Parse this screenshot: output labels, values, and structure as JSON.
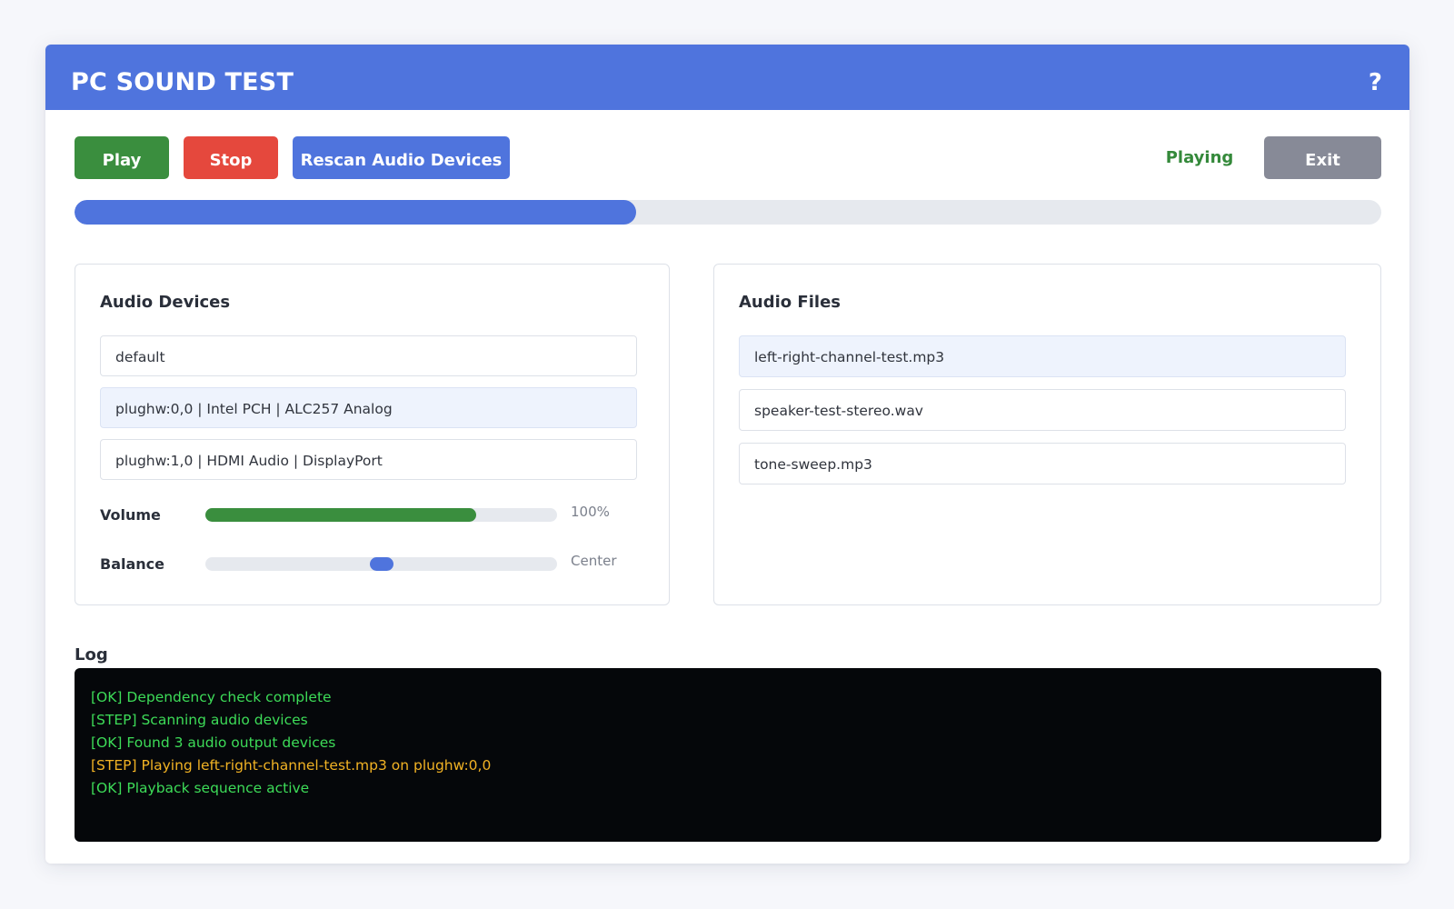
{
  "app": {
    "title": "PC SOUND TEST",
    "help_label": "?"
  },
  "toolbar": {
    "play_label": "Play",
    "stop_label": "Stop",
    "rescan_label": "Rescan Audio Devices",
    "exit_label": "Exit",
    "status": "Playing"
  },
  "progress": {
    "value": 0.43
  },
  "devices": {
    "title": "Audio Devices",
    "items": [
      {
        "label": "default",
        "selected": false
      },
      {
        "label": "plughw:0,0 | Intel PCH | ALC257 Analog",
        "selected": true
      },
      {
        "label": "plughw:1,0 | HDMI Audio | DisplayPort",
        "selected": false
      }
    ],
    "volume": {
      "label": "Volume",
      "value_text": "100%",
      "level": 0.77
    },
    "balance": {
      "label": "Balance",
      "value_text": "Center",
      "position": 0.5
    }
  },
  "files": {
    "title": "Audio Files",
    "items": [
      {
        "label": "left-right-channel-test.mp3",
        "selected": true
      },
      {
        "label": "speaker-test-stereo.wav",
        "selected": false
      },
      {
        "label": "tone-sweep.mp3",
        "selected": false
      }
    ]
  },
  "log": {
    "label": "Log",
    "lines": [
      {
        "text": "[OK] Dependency check complete",
        "color": "#3ddc58"
      },
      {
        "text": "[STEP] Scanning audio devices",
        "color": "#3ddc58"
      },
      {
        "text": "[OK] Found 3 audio output devices",
        "color": "#3ddc58"
      },
      {
        "text": "[STEP] Playing left-right-channel-test.mp3 on plughw:0,0",
        "color": "#f2b324"
      },
      {
        "text": "[OK] Playback sequence active",
        "color": "#3ddc58"
      }
    ]
  },
  "colors": {
    "accent": "#4f74dd",
    "play": "#3a8e3e",
    "stop": "#e5483d",
    "exit": "#878a97",
    "status": "#34893a",
    "log_background": "#05070a"
  }
}
